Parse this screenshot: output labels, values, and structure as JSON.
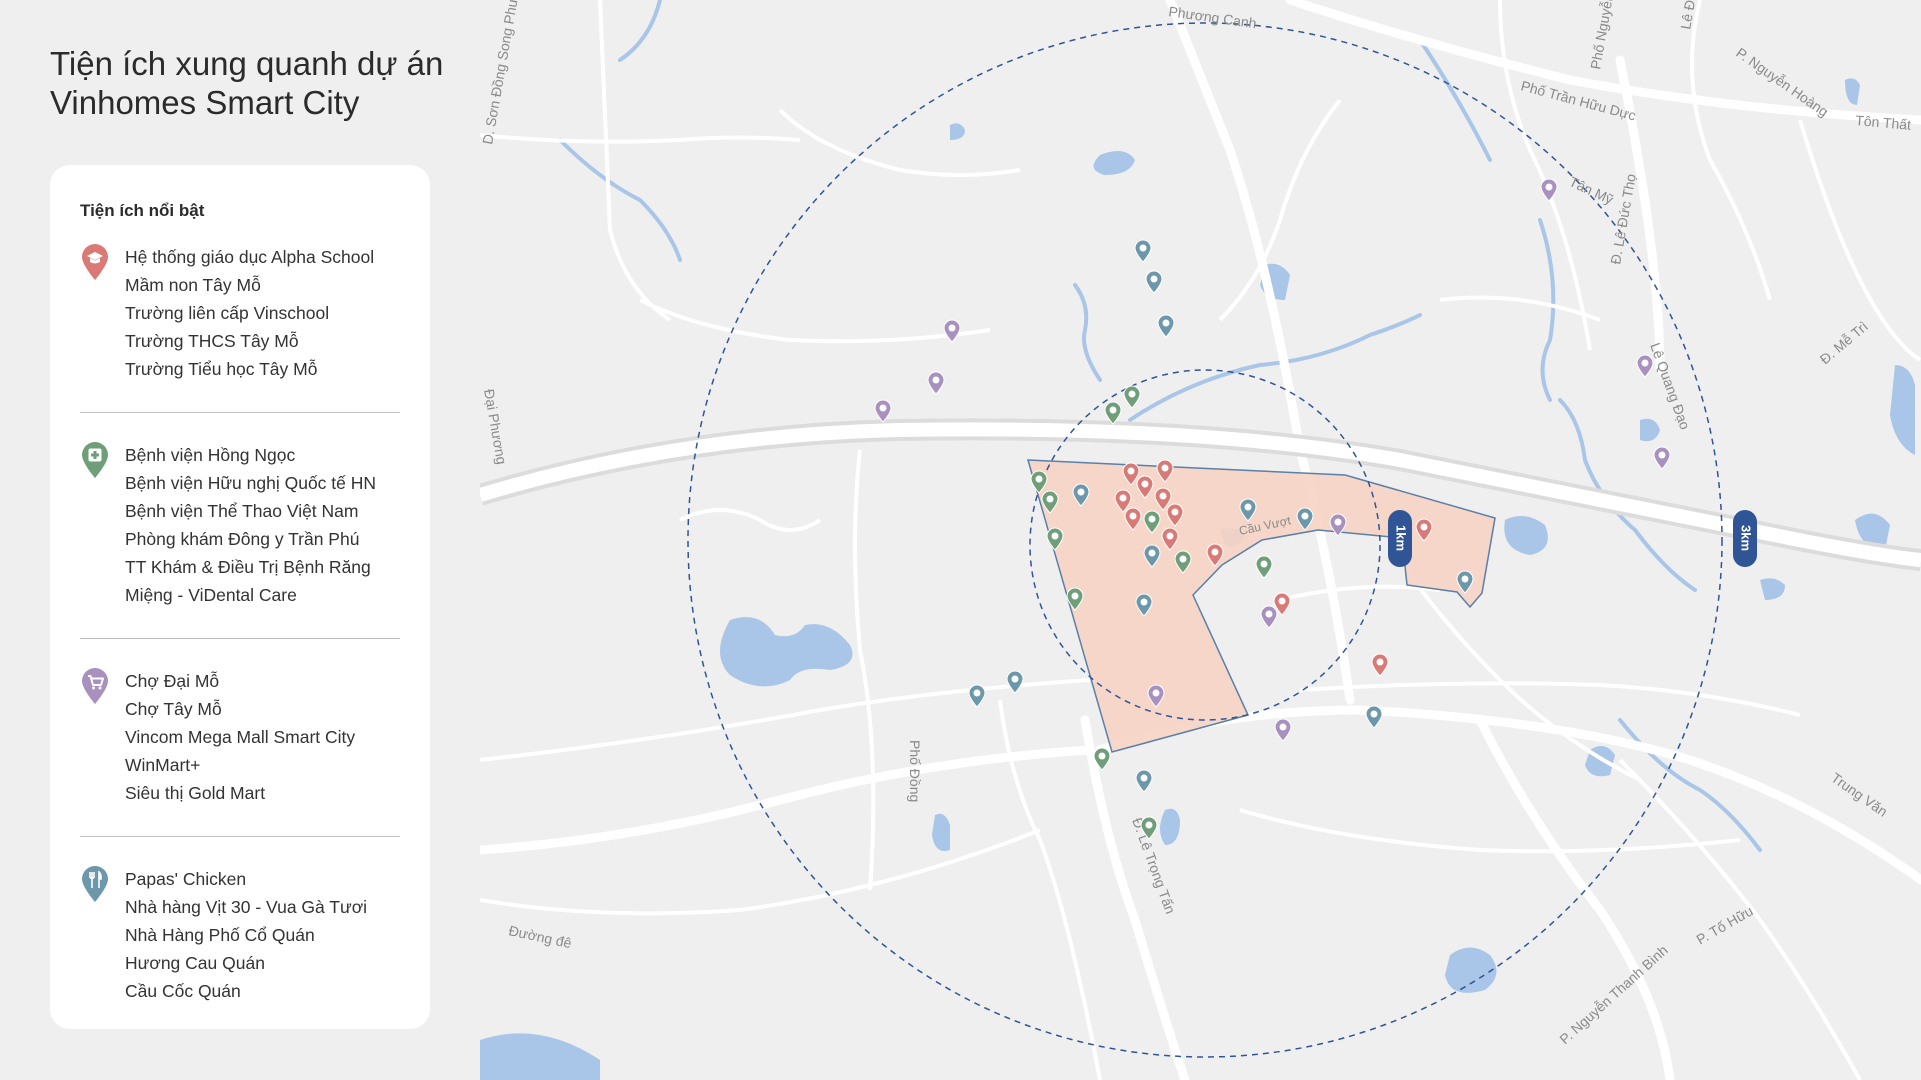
{
  "title": {
    "line1": "Tiện ích xung quanh dự án",
    "line2": "Vinhomes Smart City"
  },
  "panel": {
    "heading": "Tiện ích nổi bật",
    "groups": [
      {
        "icon": "education-pin-icon",
        "color": "#d97a76",
        "items": [
          "Hệ thống giáo dục Alpha School",
          "Mầm non Tây Mỗ",
          "Trường liên cấp Vinschool",
          "Trường THCS Tây Mỗ",
          "Trường Tiểu học Tây Mỗ"
        ]
      },
      {
        "icon": "hospital-pin-icon",
        "color": "#6f9e78",
        "items": [
          "Bệnh viện Hồng Ngọc",
          "Bệnh viện Hữu nghị Quốc tế HN",
          "Bệnh viện Thể Thao Việt Nam",
          "Phòng khám Đông y Trần Phú",
          "TT Khám & Điều Trị Bệnh Răng",
          "Miệng - ViDental Care"
        ]
      },
      {
        "icon": "shopping-cart-pin-icon",
        "color": "#a991bf",
        "items": [
          "Chợ Đại Mỗ",
          "Chợ Tây Mỗ",
          "Vincom Mega Mall Smart City",
          "WinMart+",
          "Siêu thị Gold Mart"
        ]
      },
      {
        "icon": "restaurant-pin-icon",
        "color": "#6d97aa",
        "items": [
          "Papas' Chicken",
          "Nhà hàng Vịt 30 - Vua Gà Tươi",
          "Nhà Hàng Phố Cổ Quán",
          "Hương Cau Quán",
          "Cầu Cốc Quán"
        ]
      }
    ]
  },
  "map": {
    "rings": [
      "1km",
      "3km"
    ],
    "streets": [
      "Phương Canh",
      "Phố Nguyễn",
      "Lê Đức",
      "P. Nguyễn Hoàng",
      "Tôn Thất",
      "Phố Trần Hữu Dực",
      "Tân Mỹ",
      "Đ. Lê Đức Thọ",
      "Lê Quang Đạo",
      "Đ. Mễ Trì",
      "D. Sơn Đồng Song Phương",
      "Đại Phương",
      "Phố Đồng",
      "Đ. Lê Trọng Tấn",
      "Đường đê",
      "Trung Văn",
      "P. Tố Hữu",
      "P. Nguyễn Thanh Bình",
      "Cầu Vượt"
    ],
    "colors": {
      "boundary_fill": "#f5d3c4",
      "ring": "#2f5597",
      "water": "#a9c5e8",
      "road": "#ffffff",
      "land": "#efefef"
    }
  }
}
